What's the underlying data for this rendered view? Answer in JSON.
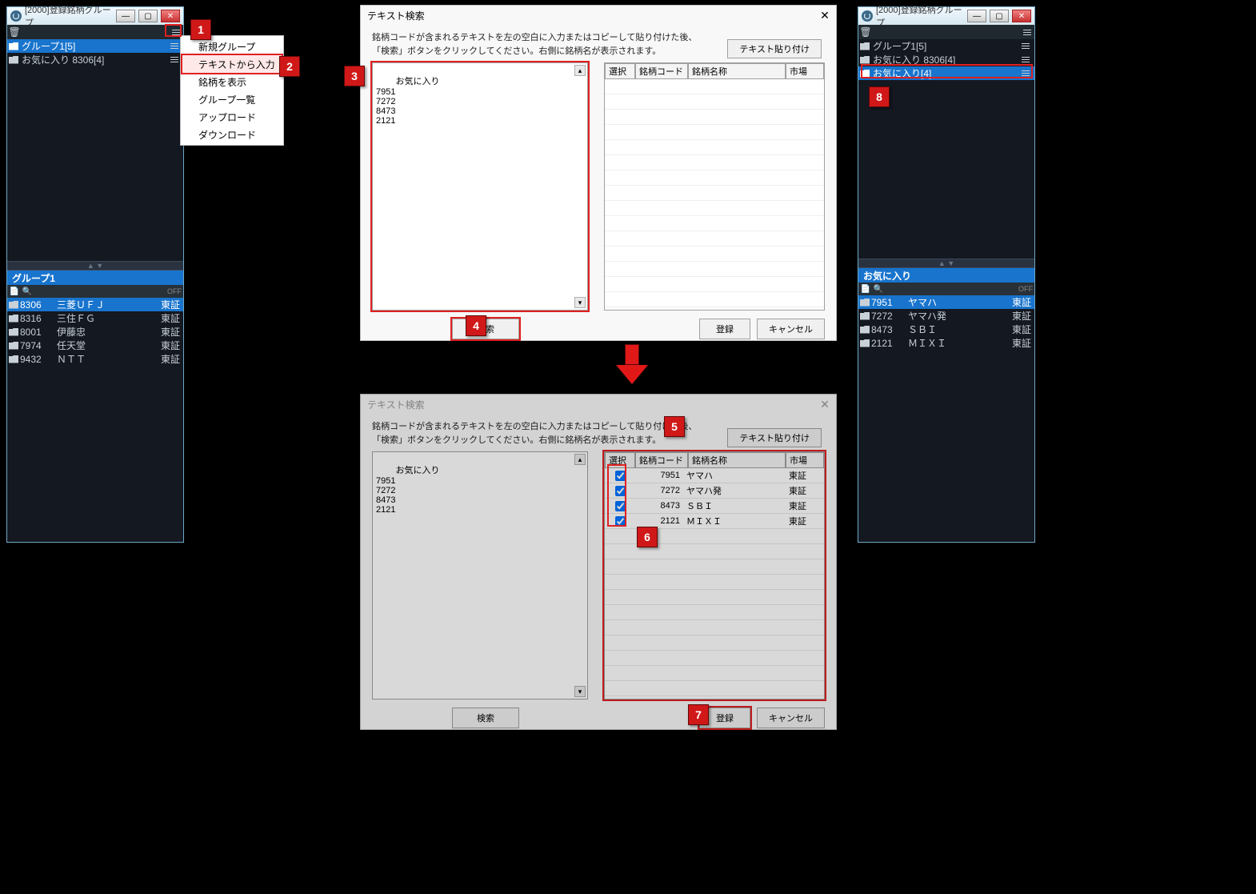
{
  "callouts": {
    "c1": "1",
    "c2": "2",
    "c3": "3",
    "c4": "4",
    "c5": "5",
    "c6": "6",
    "c7": "7",
    "c8": "8"
  },
  "window_left": {
    "title": "[2000]登録銘柄グループ",
    "groups": [
      {
        "label": "グループ1[5]",
        "selected": true
      },
      {
        "label": "お気に入り  8306[4]",
        "selected": false
      }
    ],
    "active_group_header": "グループ1",
    "off": "OFF",
    "stocks": [
      {
        "code": "8306",
        "name": "三菱ＵＦＪ",
        "market": "東証",
        "selected": true
      },
      {
        "code": "8316",
        "name": "三住ＦＧ",
        "market": "東証",
        "selected": false
      },
      {
        "code": "8001",
        "name": "伊藤忠",
        "market": "東証",
        "selected": false
      },
      {
        "code": "7974",
        "name": "任天堂",
        "market": "東証",
        "selected": false
      },
      {
        "code": "9432",
        "name": "ＮＴＴ",
        "market": "東証",
        "selected": false
      }
    ]
  },
  "context_menu": {
    "items": [
      {
        "label": "新規グループ"
      },
      {
        "label": "テキストから入力",
        "hl": true
      },
      {
        "label": "銘柄を表示"
      },
      {
        "label": "グループ一覧"
      },
      {
        "label": "アップロード"
      },
      {
        "label": "ダウンロード"
      }
    ]
  },
  "dialog": {
    "title": "テキスト検索",
    "instr1": "銘柄コードが含まれるテキストを左の空白に入力またはコピーして貼り付けた後、",
    "instr2": "「検索」ボタンをクリックしてください。右側に銘柄名が表示されます。",
    "paste_btn": "テキスト貼り付け",
    "textarea": "お気に入り\n7951\n7272\n8473\n2121",
    "grid_headers": {
      "sel": "選択",
      "code": "銘柄コード",
      "name": "銘柄名称",
      "market": "市場"
    },
    "search_btn": "検索",
    "register_btn": "登録",
    "cancel_btn": "キャンセル",
    "results": [
      {
        "code": "7951",
        "name": "ヤマハ",
        "market": "東証"
      },
      {
        "code": "7272",
        "name": "ヤマハ発",
        "market": "東証"
      },
      {
        "code": "8473",
        "name": "ＳＢＩ",
        "market": "東証"
      },
      {
        "code": "2121",
        "name": "ＭＩＸＩ",
        "market": "東証"
      }
    ]
  },
  "window_right": {
    "title": "[2000]登録銘柄グループ",
    "groups": [
      {
        "label": "グループ1[5]",
        "selected": false
      },
      {
        "label": "お気に入り  8306[4]",
        "selected": false
      },
      {
        "label": "お気に入り[4]",
        "selected": true
      }
    ],
    "active_group_header": "お気に入り",
    "off": "OFF",
    "stocks": [
      {
        "code": "7951",
        "name": "ヤマハ",
        "market": "東証",
        "selected": true
      },
      {
        "code": "7272",
        "name": "ヤマハ発",
        "market": "東証",
        "selected": false
      },
      {
        "code": "8473",
        "name": "ＳＢＩ",
        "market": "東証",
        "selected": false
      },
      {
        "code": "2121",
        "name": "ＭＩＸＩ",
        "market": "東証",
        "selected": false
      }
    ]
  }
}
